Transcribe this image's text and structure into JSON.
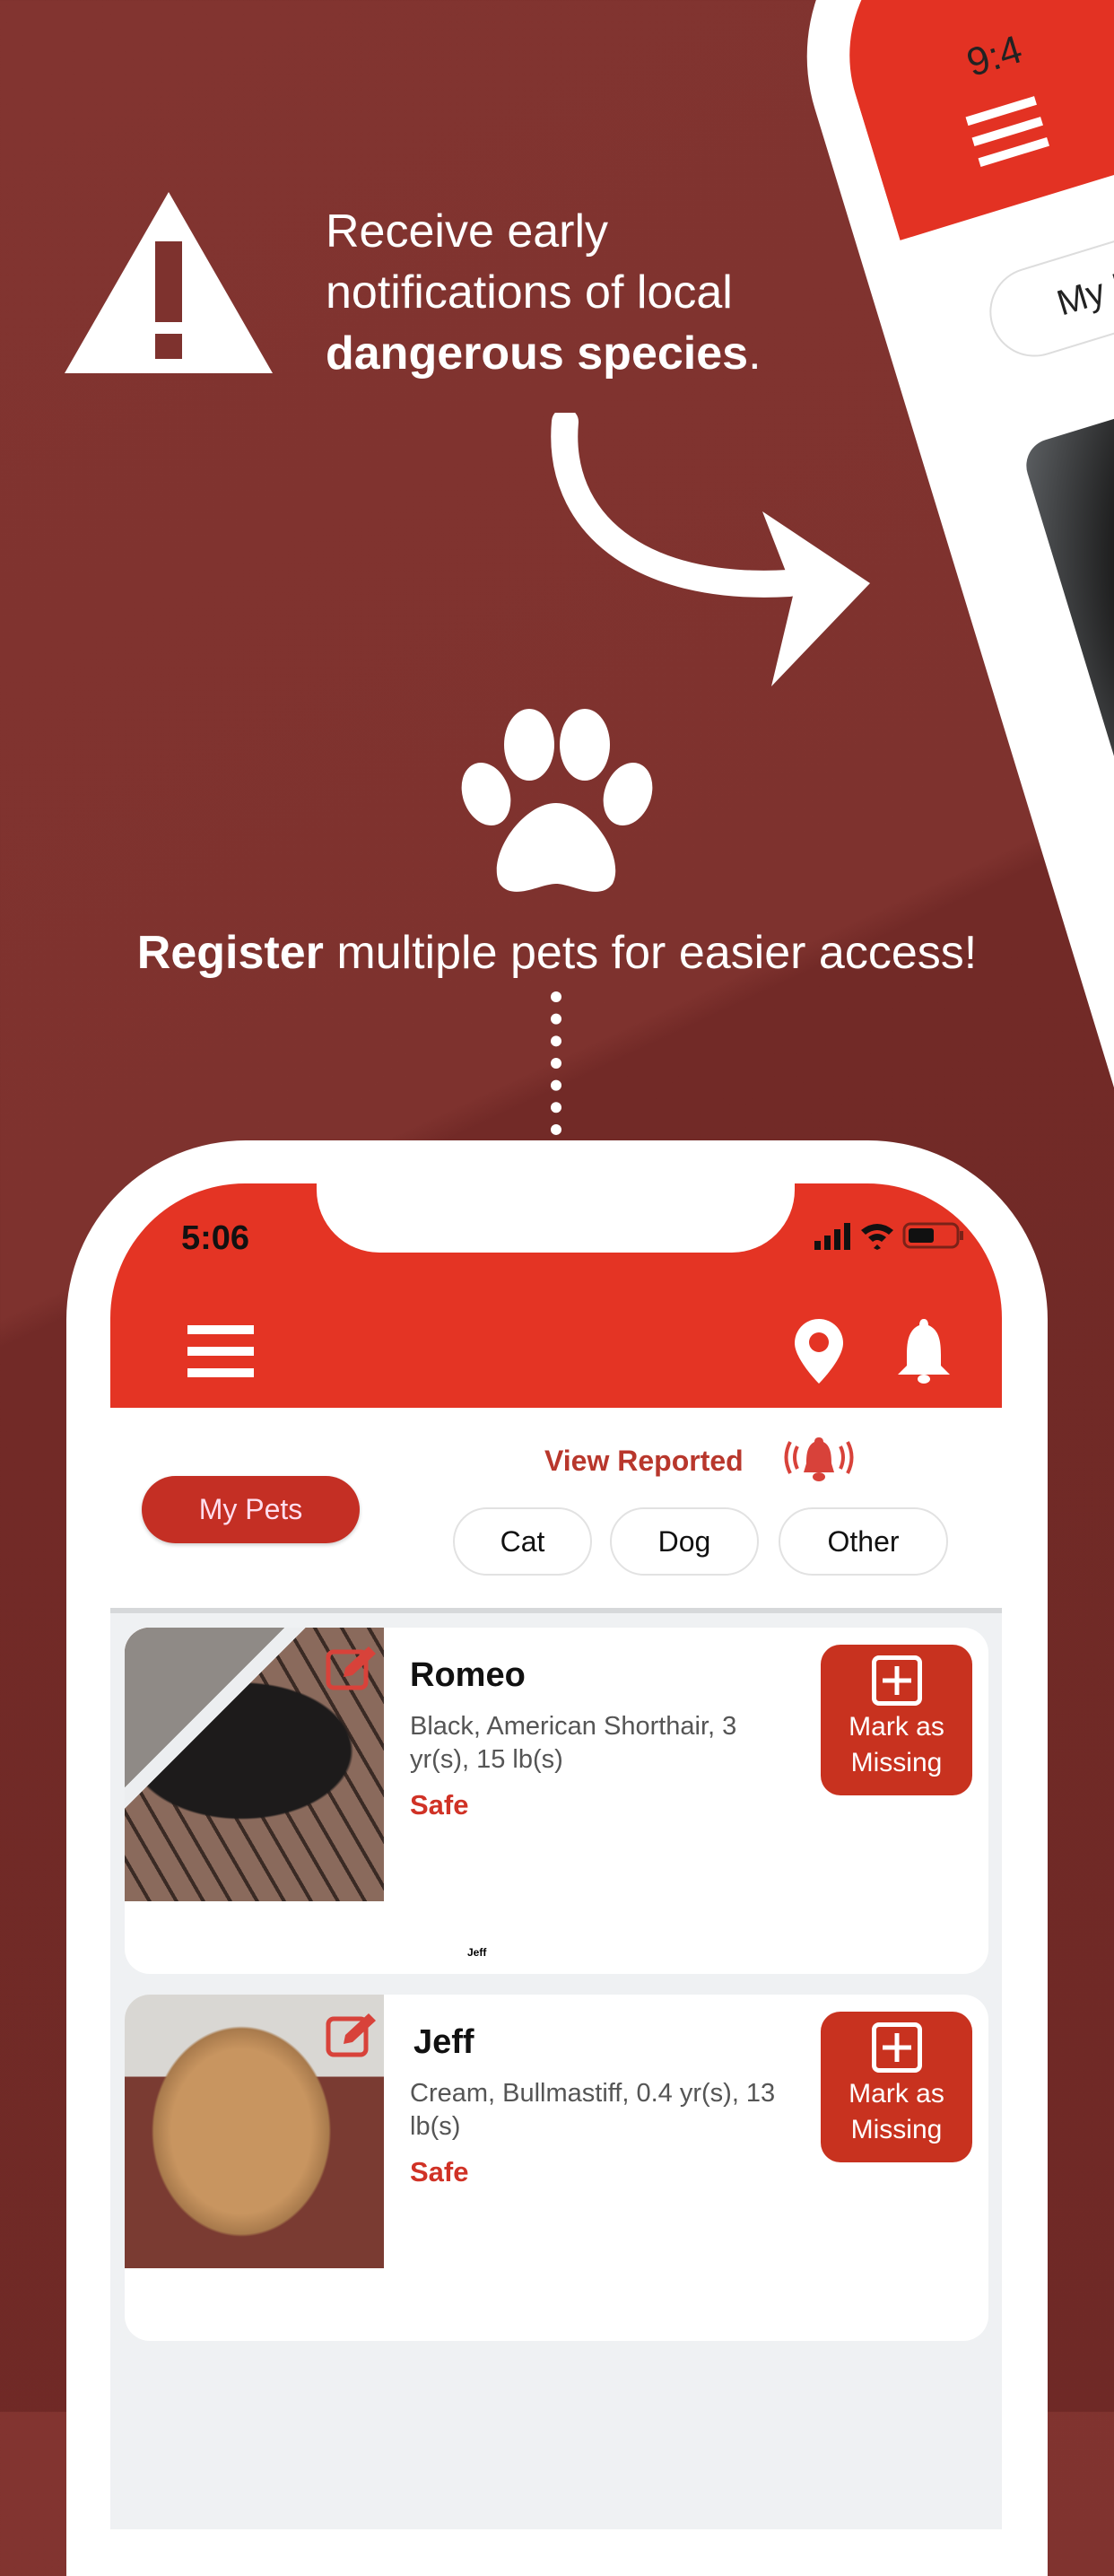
{
  "promo": {
    "line1": "Receive early",
    "line2": "notifications of local",
    "line3_bold": "dangerous species",
    "line3_end": ".",
    "register_bold": "Register",
    "register_rest": " multiple pets for easier access!"
  },
  "back_phone": {
    "time": "9:4",
    "filter_label": "My Pets"
  },
  "status_bar": {
    "time": "5:06"
  },
  "filters": {
    "view_reported": "View Reported",
    "my_pets": "My Pets",
    "cat": "Cat",
    "dog": "Dog",
    "other": "Other"
  },
  "colors": {
    "brand_red": "#e43424",
    "button_red": "#c8321f",
    "background": "#7e322e"
  },
  "pets": [
    {
      "name": "Romeo",
      "description": "Black, American Shorthair, 3 yr(s), 15 lb(s)",
      "status": "Safe",
      "action": "Mark as Missing",
      "caption": "Jeff"
    },
    {
      "name": "Jeff",
      "description": "Cream, Bullmastiff, 0.4 yr(s), 13 lb(s)",
      "status": "Safe",
      "action": "Mark as Missing"
    }
  ]
}
